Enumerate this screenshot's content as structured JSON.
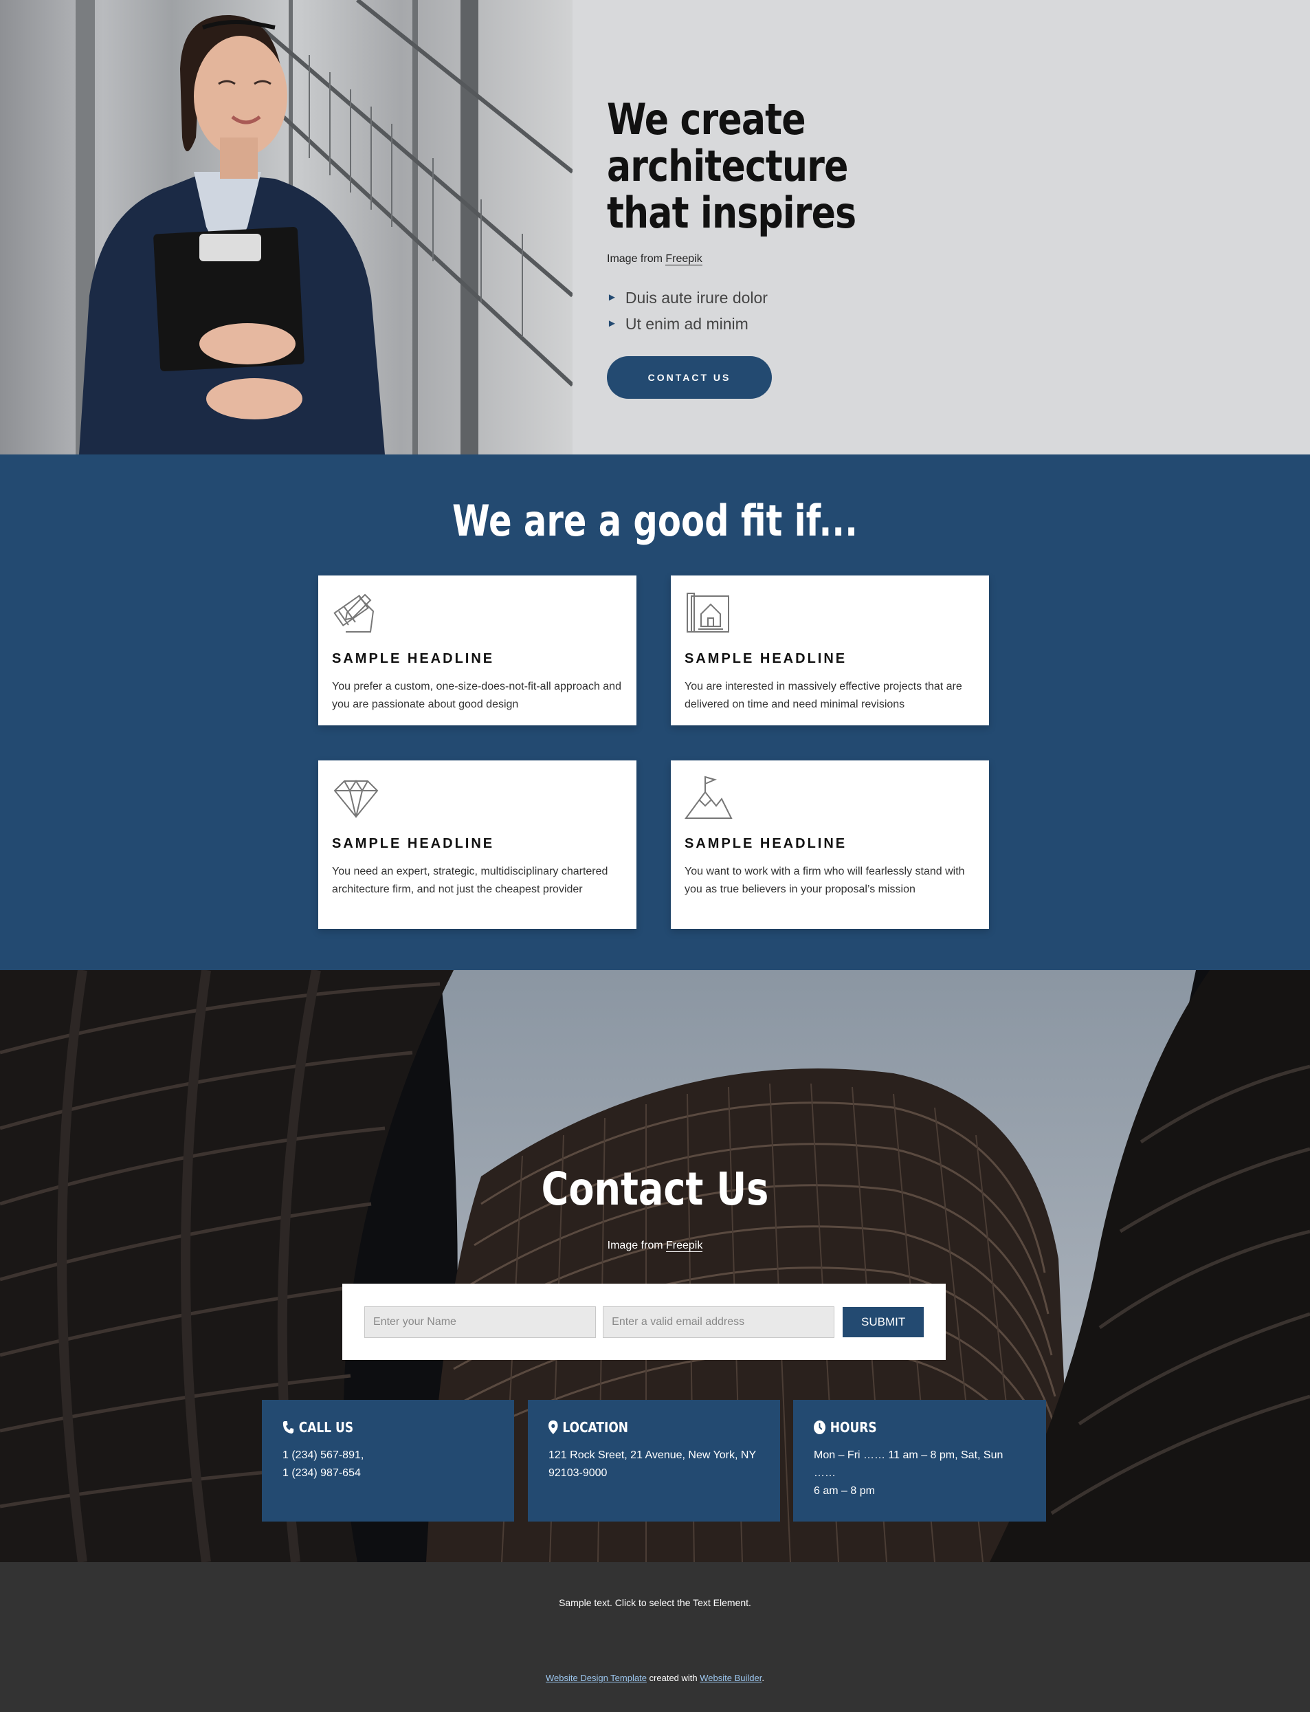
{
  "hero": {
    "title": "We create architecture\nthat inspires",
    "credit_prefix": "Image from ",
    "credit_link": "Freepik",
    "bullets": [
      "Duis aute irure dolor",
      "Ut enim ad minim"
    ],
    "bullet_icon": "triangle-right",
    "cta_label": "CONTACT US"
  },
  "fit": {
    "title": "We are a good fit if...",
    "cards": [
      {
        "icon": "drafting-tools-icon",
        "headline": "SAMPLE HEADLINE",
        "text": "You prefer a custom, one-size-does-not-fit-all approach and you are passionate about good design"
      },
      {
        "icon": "house-blueprint-icon",
        "headline": "SAMPLE HEADLINE",
        "text": "You are interested in massively effective projects that are delivered on time and need minimal revisions"
      },
      {
        "icon": "diamond-icon",
        "headline": "SAMPLE HEADLINE",
        "text": "You need an expert, strategic, multidisciplinary chartered architecture firm, and not just the cheapest provider"
      },
      {
        "icon": "mountain-flag-icon",
        "headline": "SAMPLE HEADLINE",
        "text": "You want to work with a firm who will fearlessly stand with you as true believers in your proposal’s mission"
      }
    ]
  },
  "contact": {
    "title": "Contact Us",
    "credit_prefix": "Image from ",
    "credit_link": "Freepik",
    "form": {
      "name_placeholder": "Enter your Name",
      "email_placeholder": "Enter a valid email address",
      "submit_label": "SUBMIT"
    },
    "info": [
      {
        "icon": "phone-icon",
        "title": "CALL US",
        "text": "1 (234) 567-891,\n1 (234) 987-654"
      },
      {
        "icon": "location-pin-icon",
        "title": "LOCATION",
        "text": "121 Rock Sreet, 21 Avenue, New York, NY\n92103-9000"
      },
      {
        "icon": "clock-icon",
        "title": "HOURS",
        "text": "Mon – Fri …… 11 am – 8 pm, Sat, Sun  ……\n6 am – 8 pm"
      }
    ]
  },
  "footer": {
    "text": "Sample text. Click to select the Text Element.",
    "link1": "Website Design Template",
    "middle": " created with ",
    "link2": "Website Builder",
    "end": "."
  },
  "colors": {
    "brand_blue": "#234a71",
    "hero_bg": "#d8d9db",
    "footer_bg": "#333333"
  }
}
